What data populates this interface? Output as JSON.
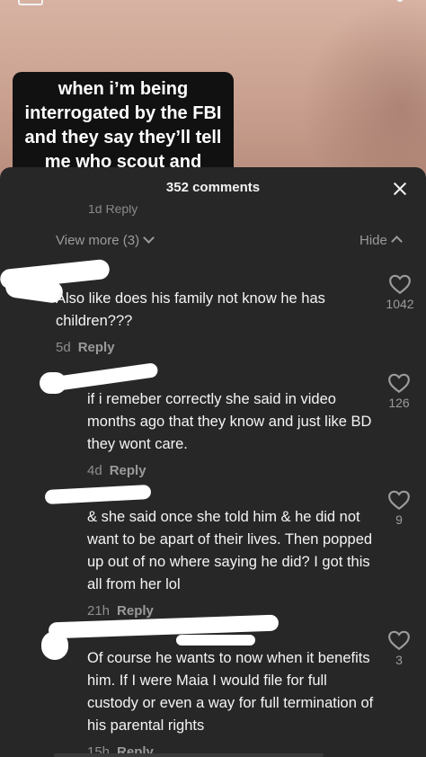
{
  "video": {
    "caption": "when i’m being interrogated by the FBI and they say they’ll tell me who scout and"
  },
  "sheet": {
    "comment_count": "352 comments",
    "clipped_reply": "1d Reply",
    "view_more": "View more (3)",
    "hide": "Hide"
  },
  "comments": [
    {
      "text": "Also like does his family not know he has children???",
      "age": "5d",
      "reply_label": "Reply",
      "likes": "1042"
    },
    {
      "text": "if i remeber correctly she said in video months ago that they know and just like BD they wont care.",
      "age": "4d",
      "reply_label": "Reply",
      "likes": "126"
    },
    {
      "text": "& she said once she told him & he did not want to be apart of their lives. Then popped up out of no where saying he did? I got this all from her lol",
      "age": "21h",
      "reply_label": "Reply",
      "likes": "9"
    },
    {
      "text": "Of course he wants to now when it benefits him. If I were Maia I would file for full custody or even a way for full termination of his parental rights",
      "age": "15h",
      "reply_label": "Reply",
      "likes": "3"
    }
  ],
  "icons": {
    "heart": "heart-outline-icon",
    "close": "close-icon",
    "chevron_down": "chevron-down-icon",
    "chevron_up": "chevron-up-icon"
  },
  "colors": {
    "sheet_bg": "#272727",
    "text": "#f4f4f4",
    "muted": "#8e8e8e"
  }
}
